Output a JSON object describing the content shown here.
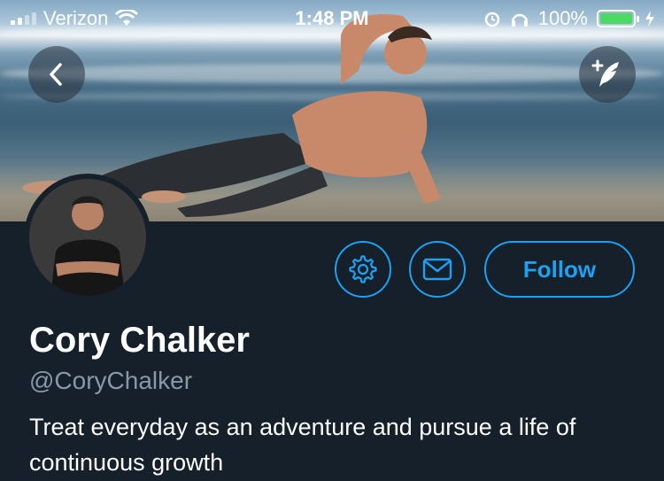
{
  "status_bar": {
    "carrier": "Verizon",
    "time": "1:48 PM",
    "battery_percent": "100%",
    "battery_level": 1.0,
    "icons": [
      "signal-icon",
      "wifi-icon",
      "alarm-icon",
      "headphones-icon",
      "battery-icon",
      "charging-icon"
    ]
  },
  "header": {
    "back_icon": "chevron-left-icon",
    "compose_icon": "compose-tweet-icon"
  },
  "profile": {
    "name": "Cory Chalker",
    "handle": "@CoryChalker",
    "bio": "Treat everyday as an adventure and pursue a life of continuous growth"
  },
  "actions": {
    "settings_icon": "gear-icon",
    "message_icon": "envelope-icon",
    "follow_label": "Follow"
  },
  "colors": {
    "background": "#15202b",
    "accent": "#1da1f2",
    "secondary_text": "#8899a6",
    "battery": "#4cd964"
  }
}
